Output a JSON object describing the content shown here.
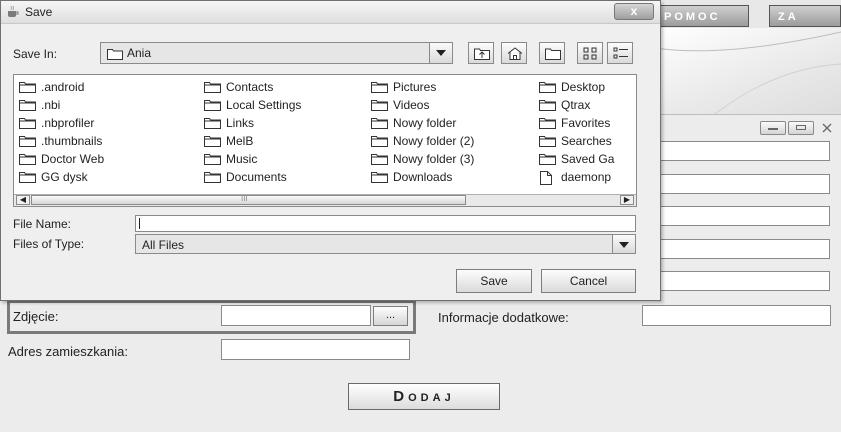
{
  "background_app": {
    "menu": [
      "POMOC",
      "ZA"
    ],
    "labels": {
      "photo": "Zdjęcie:",
      "address": "Adres zamieszkania:",
      "extra_info": "Informacje dodatkowe:"
    },
    "browse_button": "...",
    "add_button": "Dodaj"
  },
  "dialog": {
    "title": "Save",
    "close_label": "x",
    "save_in_label": "Save In:",
    "save_in_value": "Ania",
    "files": [
      [
        ".android",
        ".nbi",
        ".nbprofiler",
        ".thumbnails",
        "Doctor Web",
        "GG dysk"
      ],
      [
        "Contacts",
        "Local Settings",
        "Links",
        "MelB",
        "Music",
        "Documents"
      ],
      [
        "Pictures",
        "Videos",
        "Nowy folder",
        "Nowy folder (2)",
        "Nowy folder (3)",
        "Downloads"
      ],
      [
        "Desktop",
        "Qtrax",
        "Favorites",
        "Searches",
        "Saved Ga",
        "daemonp"
      ]
    ],
    "file_name_label": "File Name:",
    "file_name_value": "",
    "file_type_label": "Files of Type:",
    "file_type_value": "All Files",
    "save_button": "Save",
    "cancel_button": "Cancel",
    "scroll_grip": "III"
  },
  "colors": {
    "window_bg": "#ececec",
    "menu_gradient": "#9c9c9c",
    "close_button": "#b0b0b0"
  }
}
